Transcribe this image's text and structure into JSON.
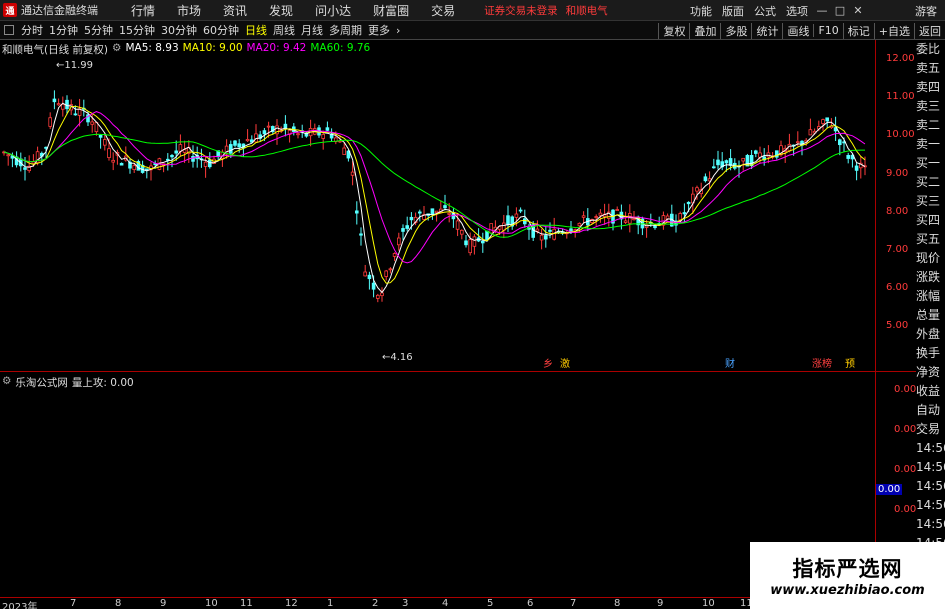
{
  "titlebar": {
    "app_name": "通达信金融终端",
    "menu": [
      "行情",
      "市场",
      "资讯",
      "发现",
      "问小达",
      "财富圈",
      "交易"
    ],
    "warning": "证券交易未登录",
    "stock_name": "和顺电气",
    "right_menu": [
      "功能",
      "版面",
      "公式",
      "选项"
    ],
    "guest": "游客"
  },
  "toolbar": {
    "periods": [
      "分时",
      "1分钟",
      "5分钟",
      "15分钟",
      "30分钟",
      "60分钟",
      "日线",
      "周线",
      "月线",
      "多周期",
      "更多"
    ],
    "active": "日线",
    "right": [
      "复权",
      "叠加",
      "多股",
      "统计",
      "画线",
      "F10",
      "标记",
      "+自选",
      "返回"
    ]
  },
  "legend": {
    "title": "和顺电气(日线 前复权)",
    "ma5_label": "MA5: 8.93",
    "ma10_label": "MA10: 9.00",
    "ma20_label": "MA20: 9.42",
    "ma60_label": "MA60: 9.76",
    "colors": {
      "ma5": "#ffffff",
      "ma10": "#ffff00",
      "ma20": "#ff00ff",
      "ma60": "#00ff00"
    }
  },
  "indicator": {
    "title": "乐淘公式网",
    "value_label": "量上攻: 0.00"
  },
  "price_axis": [
    "12.00",
    "11.00",
    "10.00",
    "9.00",
    "8.00",
    "7.00",
    "6.00",
    "5.00"
  ],
  "indicator_axis": [
    "0.00",
    "0.00",
    "0.00",
    "0.00",
    "0.00"
  ],
  "indicator_highlight": "0.00",
  "annotations": {
    "high": "11.99",
    "low": "4.16"
  },
  "event_tags": [
    {
      "text": "乡",
      "color": "#ff4040"
    },
    {
      "text": "激",
      "color": "#ffcc00"
    },
    {
      "text": "财",
      "color": "#4aa3ff"
    },
    {
      "text": "涨榜",
      "color": "#ff4040"
    },
    {
      "text": "预",
      "color": "#ffcc00"
    }
  ],
  "quote_labels": [
    "委比",
    "卖五",
    "卖四",
    "卖三",
    "卖二",
    "卖一",
    "买一",
    "买二",
    "买三",
    "买四",
    "买五",
    "现价",
    "涨跌",
    "涨幅",
    "总量",
    "外盘",
    "换手",
    "净资",
    "收益",
    "自动",
    "交易",
    "14:56",
    "14:56",
    "14:56",
    "14:56",
    "14:56",
    "14:56",
    "14:56"
  ],
  "x_axis": [
    "2023年",
    "7",
    "8",
    "9",
    "10",
    "11",
    "12",
    "1",
    "2",
    "3",
    "4",
    "5",
    "6",
    "7",
    "8",
    "9",
    "10",
    "11"
  ],
  "watermark": {
    "cn": "指标严选网",
    "en": "www.xuezhibiao.com"
  }
}
